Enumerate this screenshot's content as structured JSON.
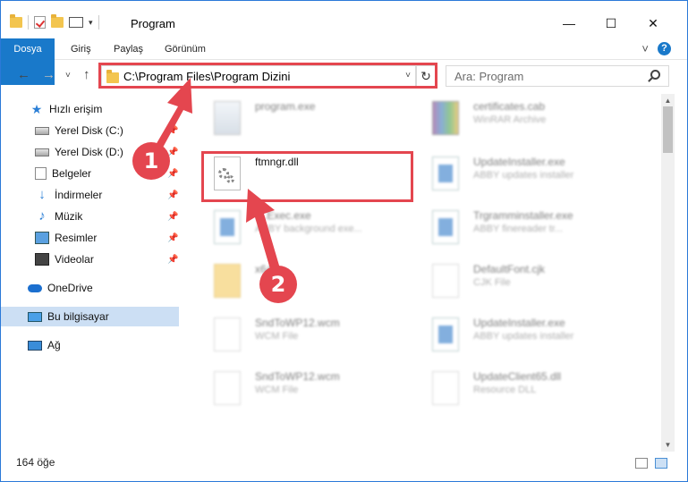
{
  "window": {
    "title": "Program",
    "minimize": "—",
    "maximize": "☐",
    "close": "✕"
  },
  "ribbon": {
    "tabs": [
      "Dosya",
      "Giriş",
      "Paylaş",
      "Görünüm"
    ],
    "help": "?",
    "collapse": "˅"
  },
  "nav": {
    "back": "←",
    "forward": "→",
    "recent": "˅",
    "up": "↑",
    "path": "C:\\Program Files\\Program Dizini",
    "refresh": "↻",
    "search_placeholder": "Ara: Program"
  },
  "sidebar": {
    "items": [
      {
        "label": "Hızlı erişim",
        "icon": "star-icon"
      },
      {
        "label": "Yerel Disk (C:)",
        "icon": "drive-icon",
        "pinned": true
      },
      {
        "label": "Yerel Disk (D:)",
        "icon": "drive-icon",
        "pinned": true
      },
      {
        "label": "Belgeler",
        "icon": "documents-icon",
        "pinned": true
      },
      {
        "label": "İndirmeler",
        "icon": "downloads-icon",
        "pinned": true
      },
      {
        "label": "Müzik",
        "icon": "music-icon",
        "pinned": true
      },
      {
        "label": "Resimler",
        "icon": "pictures-icon",
        "pinned": true
      },
      {
        "label": "Videolar",
        "icon": "videos-icon",
        "pinned": true
      },
      {
        "label": "OneDrive",
        "icon": "cloud-icon"
      },
      {
        "label": "Bu bilgisayar",
        "icon": "computer-icon",
        "selected": true
      },
      {
        "label": "Ağ",
        "icon": "network-icon"
      }
    ]
  },
  "files": [
    {
      "name": "program.exe",
      "type": "",
      "icon": "exe-icon"
    },
    {
      "name": "certificates.cab",
      "type": "WinRAR Archive",
      "icon": "archive-icon"
    },
    {
      "name": "ftmngr.dll",
      "type": "",
      "icon": "dll-icon",
      "highlighted": true
    },
    {
      "name": "UpdateInstaller.exe",
      "type": "ABBY updates installer",
      "icon": "installer-icon"
    },
    {
      "name": "....Exec.exe",
      "type": "ABBY background exe...",
      "icon": "installer-icon"
    },
    {
      "name": "Trgramminstaller.exe",
      "type": "ABBY finereader tr...",
      "icon": "installer-icon"
    },
    {
      "name": "x64",
      "type": "",
      "icon": "folder-icon"
    },
    {
      "name": "DefaultFont.cjk",
      "type": "CJK File",
      "icon": "document-icon"
    },
    {
      "name": "SndToWP12.wcm",
      "type": "WCM File",
      "icon": "document-icon"
    },
    {
      "name": "UpdateInstaller.exe",
      "type": "ABBY updates installer",
      "icon": "installer-icon"
    },
    {
      "name": "SndToWP12.wcm",
      "type": "WCM File",
      "icon": "document-icon"
    },
    {
      "name": "UpdateClient65.dll",
      "type": "Resource DLL",
      "icon": "dll-icon"
    }
  ],
  "status": {
    "count": "164 öğe"
  },
  "annotations": {
    "step1": "1",
    "step2": "2",
    "color": "#e4464f"
  }
}
